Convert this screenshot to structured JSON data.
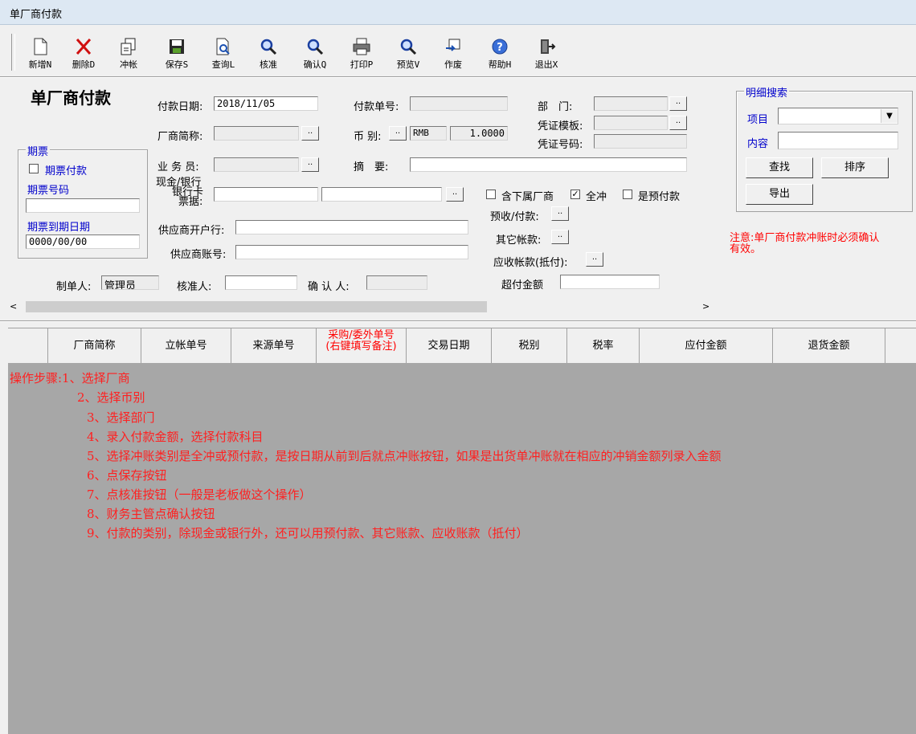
{
  "window": {
    "title": "单厂商付款"
  },
  "toolbar": [
    {
      "label": "新增N",
      "icon": "new-doc-icon"
    },
    {
      "label": "删除D",
      "icon": "delete-x-icon"
    },
    {
      "label": "冲帐",
      "icon": "copy-icon"
    },
    {
      "label": "保存S",
      "icon": "save-icon"
    },
    {
      "label": "查询L",
      "icon": "query-icon"
    },
    {
      "label": "核准",
      "icon": "magnifier-icon"
    },
    {
      "label": "确认Q",
      "icon": "magnifier-icon"
    },
    {
      "label": "打印P",
      "icon": "printer-icon"
    },
    {
      "label": "预览V",
      "icon": "magnifier-icon"
    },
    {
      "label": "作废",
      "icon": "void-icon"
    },
    {
      "label": "帮助H",
      "icon": "help-icon"
    },
    {
      "label": "退出X",
      "icon": "exit-door-icon"
    }
  ],
  "form": {
    "heading": "单厂商付款",
    "pay_date_label": "付款日期:",
    "pay_date_value": "2018/11/05",
    "pay_no_label": "付款单号:",
    "dept_label": "部　门:",
    "voucher_tpl_label": "凭证模板:",
    "voucher_no_label": "凭证号码:",
    "vendor_label": "厂商简称:",
    "currency_label": "币 别:",
    "currency_value": "RMB",
    "rate_value": "1.0000",
    "staff_label": "业 务 员:",
    "memo_label": "摘　要:",
    "cash_bank_label": "现金/银行",
    "bank_card_label": "银行卡",
    "bill_label": "票据:",
    "bank_open_label": "供应商开户行:",
    "bank_acct_label": "供应商账号:",
    "incl_sub_label": "含下属厂商",
    "full_offset_label": "全冲",
    "prepay_label": "是预付款",
    "prepay_btn_label": "预收/付款:",
    "other_label": "其它帐款:",
    "receivable_label": "应收帐款(抵付):",
    "overpay_label": "超付金额",
    "maker_label": "制单人:",
    "maker_value": "管理员",
    "approver_label": "核准人:",
    "confirmer_label": "确 认 人:"
  },
  "promissory": {
    "group_title": "期票",
    "checkbox_label": "期票付款",
    "number_label": "期票号码",
    "due_label": "期票到期日期",
    "due_value": "0000/00/00"
  },
  "search": {
    "group_title": "明细搜索",
    "item_label": "项目",
    "content_label": "内容",
    "find_btn": "查找",
    "sort_btn": "排序",
    "export_btn": "导出"
  },
  "notice": [
    "注意:单厂商付款冲账时必须确认",
    "有效。"
  ],
  "grid": {
    "columns": [
      "厂商简称",
      "立帐单号",
      "来源单号",
      "采购/委外单号",
      "交易日期",
      "税别",
      "税率",
      "应付金额",
      "退货金额"
    ],
    "special_col_sub": "(右键填写备注)"
  },
  "steps": [
    "操作步骤:1、选择厂商",
    "2、选择币别",
    "3、选择部门",
    "4、录入付款金额，选择付款科目",
    "5、选择冲账类别是全冲或预付款，是按日期从前到后就点冲账按钮，如果是出货单冲账就在相应的冲销金额列录入金额",
    "6、点保存按钮",
    "7、点核准按钮（一般是老板做这个操作）",
    "8、财务主管点确认按钮",
    "9、付款的类别，除现金或银行外，还可以用预付款、其它账款、应收账款（抵付）"
  ],
  "colors": {
    "grid_bg": "#a7a7a7",
    "step_text": "#ff2020",
    "notice_text": "#ff0000",
    "label_blue": "#0000cc"
  }
}
